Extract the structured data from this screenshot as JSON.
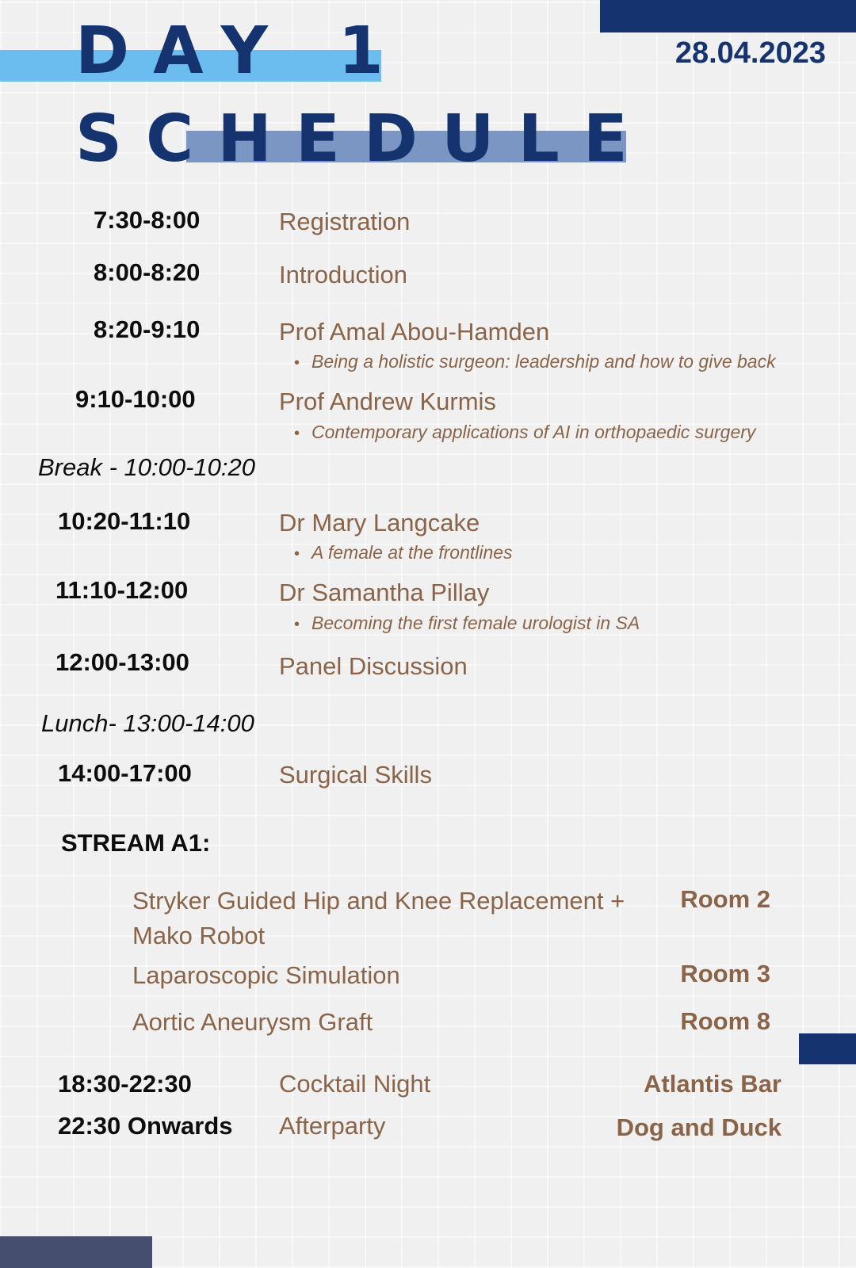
{
  "header": {
    "title_line1": "DAY 1",
    "title_line2": "SCHEDULE",
    "date": "28.04.2023"
  },
  "colors": {
    "navy": "#15346f",
    "light_blue": "#6bbdf0",
    "mid_blue": "#7b96c2",
    "brown_text": "#8a6448",
    "black_text": "#0d0d0d",
    "slate": "#454e6e"
  },
  "schedule": [
    {
      "time": "7:30-8:00",
      "title": "Registration"
    },
    {
      "time": "8:00-8:20",
      "title": "Introduction"
    },
    {
      "time": "8:20-9:10",
      "title": "Prof Amal Abou-Hamden",
      "subtitle": "Being a holistic surgeon: leadership and how to give back"
    },
    {
      "time": "9:10-10:00",
      "title": "Prof Andrew Kurmis",
      "subtitle": "Contemporary applications of AI in orthopaedic surgery"
    },
    {
      "time": "10:20-11:10",
      "title": "Dr Mary Langcake",
      "subtitle": "A female at the frontlines"
    },
    {
      "time": "11:10-12:00",
      "title": "Dr Samantha Pillay",
      "subtitle": "Becoming the first female urologist in SA"
    },
    {
      "time": "12:00-13:00",
      "title": "Panel Discussion"
    },
    {
      "time": "14:00-17:00",
      "title": "Surgical Skills"
    }
  ],
  "breaks": {
    "break": "Break - 10:00-10:20",
    "lunch": "Lunch- 13:00-14:00"
  },
  "stream": {
    "label": "STREAM A1:",
    "items": [
      {
        "name": "Stryker Guided Hip and Knee Replacement + Mako Robot",
        "room": "Room 2"
      },
      {
        "name": "Laparoscopic Simulation",
        "room": "Room 3"
      },
      {
        "name": "Aortic Aneurysm Graft",
        "room": "Room 8"
      }
    ]
  },
  "evening": [
    {
      "time": "18:30-22:30",
      "title": "Cocktail Night",
      "venue": "Atlantis Bar"
    },
    {
      "time": "22:30 Onwards",
      "title": "Afterparty",
      "venue": "Dog and Duck"
    }
  ]
}
